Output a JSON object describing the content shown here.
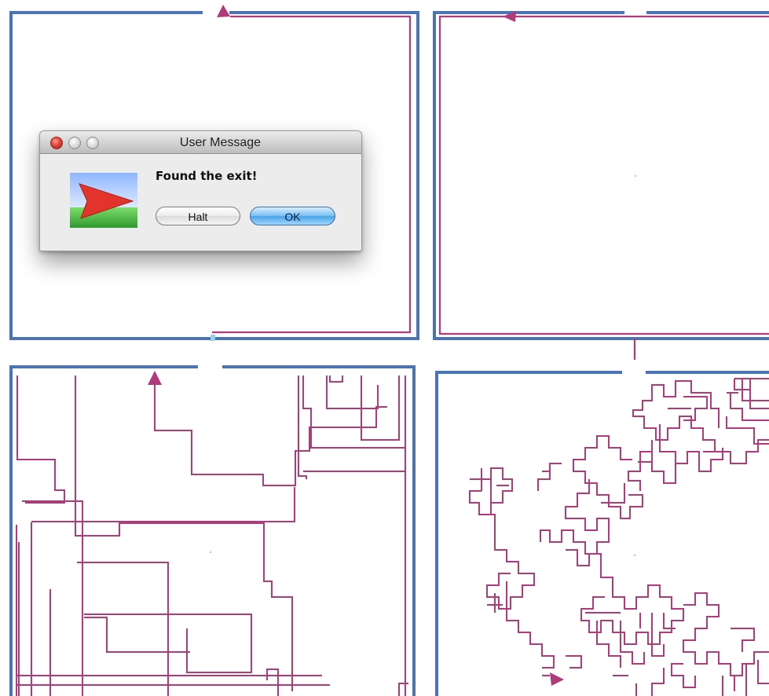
{
  "dialog": {
    "title": "User Message",
    "message": "Found the exit!",
    "halt_label": "Halt",
    "ok_label": "OK",
    "icon": "red-arrow-on-sky-and-grass-icon"
  },
  "colors": {
    "maze_wall": "#4a73b8",
    "path": "#b03a7c",
    "background": "#ffffff",
    "ok_button": "#5aacec"
  },
  "panels": [
    {
      "name": "panel-top-left",
      "walk": "straight",
      "description_icon": "arrow-up-icon"
    },
    {
      "name": "panel-top-right",
      "walk": "straight",
      "description_icon": "arrow-left-icon"
    },
    {
      "name": "panel-bottom-left",
      "walk": "long-segments",
      "description_icon": "arrow-up-icon"
    },
    {
      "name": "panel-bottom-right",
      "walk": "random",
      "description_icon": "arrow-right-icon"
    }
  ]
}
